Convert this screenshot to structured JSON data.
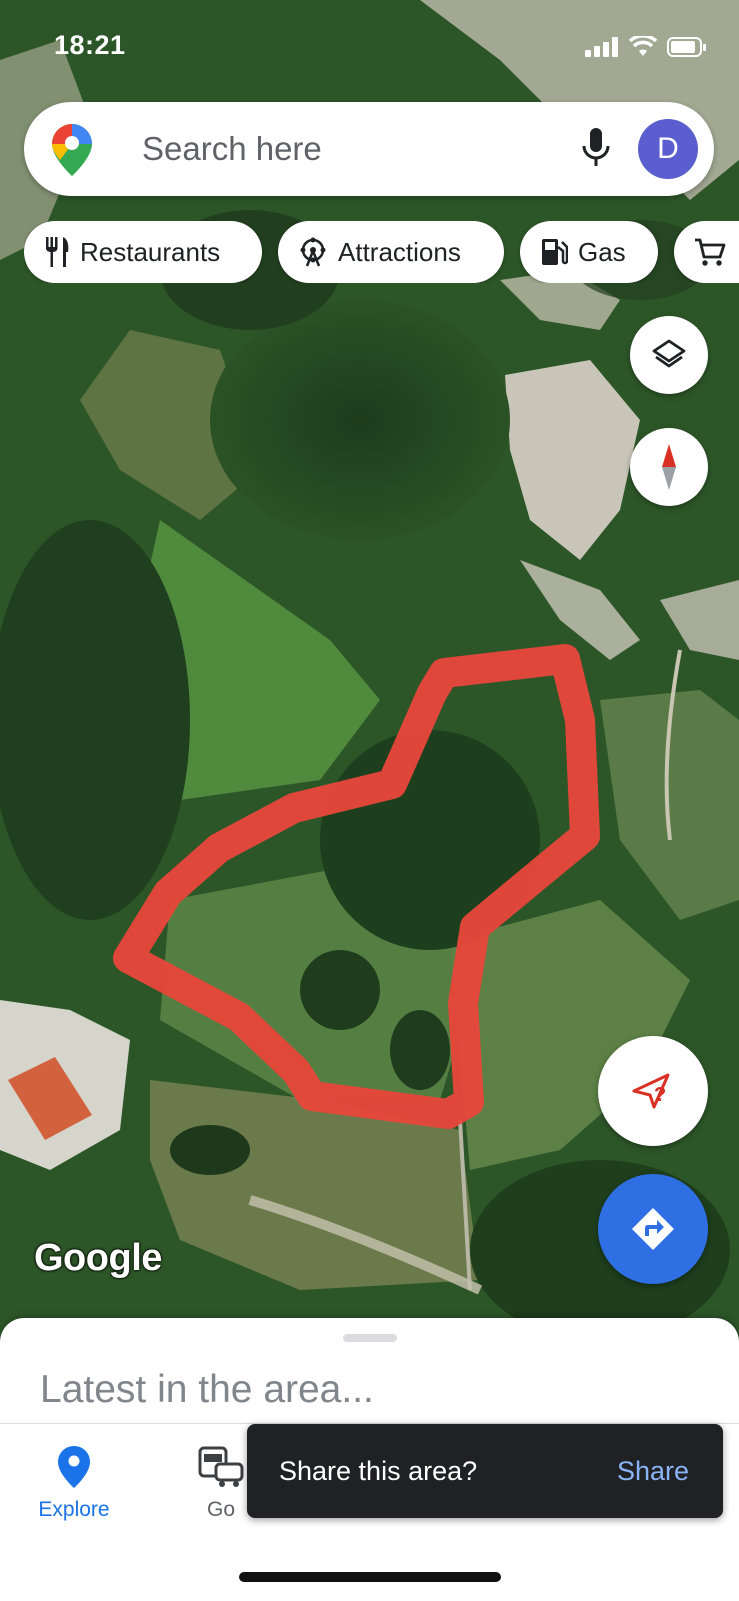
{
  "status_bar": {
    "time": "18:21"
  },
  "search": {
    "placeholder": "Search here",
    "avatar_letter": "D"
  },
  "chips": [
    {
      "label": "Restaurants",
      "icon": "fork-knife-icon"
    },
    {
      "label": "Attractions",
      "icon": "ferris-wheel-icon"
    },
    {
      "label": "Gas",
      "icon": "gas-pump-icon"
    },
    {
      "label": "",
      "icon": "cart-icon"
    }
  ],
  "map": {
    "watermark": "Google",
    "overlay_color": "#e8473a"
  },
  "bottom_sheet": {
    "title": "Latest in the area..."
  },
  "nav": {
    "explore": "Explore",
    "go": "Go"
  },
  "snackbar": {
    "message": "Share this area?",
    "action": "Share"
  },
  "colors": {
    "accent": "#1a73e8",
    "directions_fab": "#2f6fe4",
    "compass_red": "#d93025"
  }
}
